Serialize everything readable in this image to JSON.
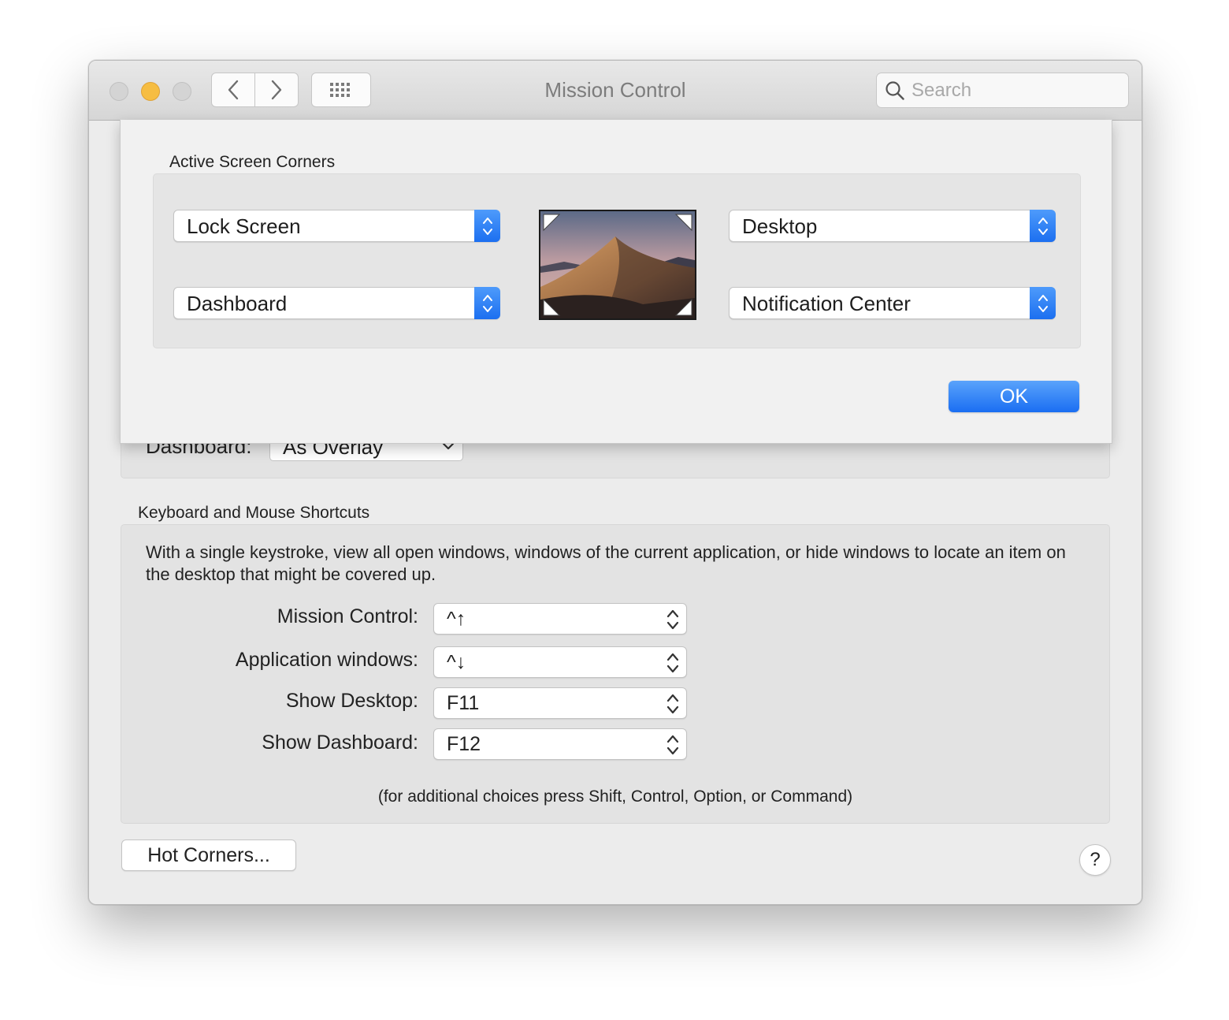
{
  "window": {
    "title": "Mission Control"
  },
  "toolbar": {
    "search_placeholder": "Search"
  },
  "background": {
    "dashboard_label": "Dashboard:",
    "dashboard_value": "As Overlay"
  },
  "shortcuts": {
    "section_title": "Keyboard and Mouse Shortcuts",
    "description": "With a single keystroke, view all open windows, windows of the current application, or hide windows to locate an item on the desktop that might be covered up.",
    "rows": [
      {
        "label": "Mission Control:",
        "value": "^↑"
      },
      {
        "label": "Application windows:",
        "value": "^↓"
      },
      {
        "label": "Show Desktop:",
        "value": "F11"
      },
      {
        "label": "Show Dashboard:",
        "value": "F12"
      }
    ],
    "hint": "(for additional choices press Shift, Control, Option, or Command)"
  },
  "buttons": {
    "hot_corners": "Hot Corners...",
    "help": "?"
  },
  "sheet": {
    "title": "Active Screen Corners",
    "corners": {
      "top_left": "Lock Screen",
      "bottom_left": "Dashboard",
      "top_right": "Desktop",
      "bottom_right": "Notification Center"
    },
    "ok_label": "OK"
  },
  "colors": {
    "accent": "#1c6ff0",
    "minimize": "#f6bd42",
    "window_bg": "#ececec"
  }
}
